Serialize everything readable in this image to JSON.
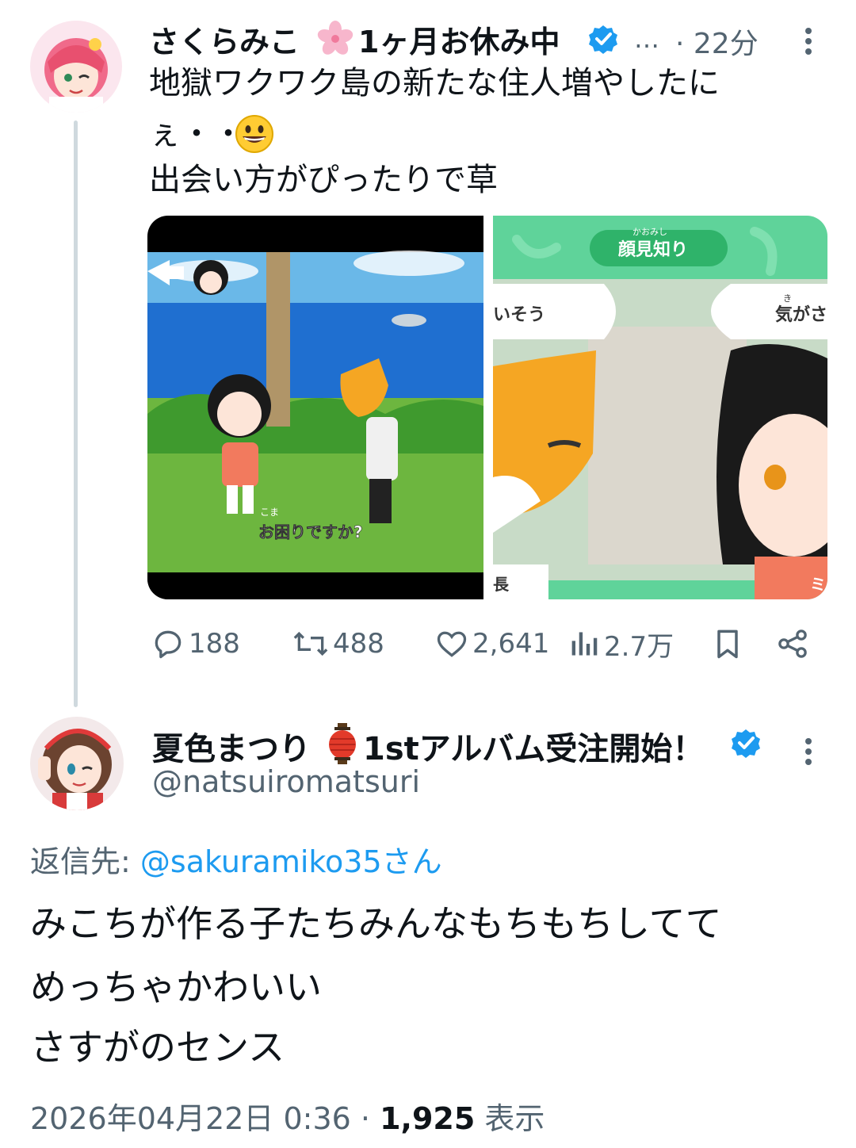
{
  "tweet1": {
    "display_name": "さくらみこ",
    "display_name_suffix": "1ヶ月お休み中",
    "name_emoji": "cherry-blossom",
    "truncation": "…",
    "time": "· 22分",
    "text_lines": [
      "地獄ワクワク島の新たな住人増やしたに",
      "ぇ・・・",
      "出会い方がぴったりで草"
    ],
    "text_emoji": "grinning-face",
    "media": {
      "left_caption_ruby": "こま",
      "left_caption": "お困りですか?",
      "right_sign_ruby": "かおみし",
      "right_sign": "顔見知り",
      "right_bubble_left": "いそう",
      "right_bubble_right_ruby": "き",
      "right_bubble_right": "気がさ",
      "right_bottom_left": "長",
      "right_bottom_right": "ミ"
    },
    "actions": {
      "replies": "188",
      "retweets": "488",
      "likes": "2,641",
      "views": "2.7万"
    }
  },
  "tweet2": {
    "display_name": "夏色まつり",
    "name_emoji": "lantern",
    "display_name_suffix": "1stアルバム受注開始！",
    "handle": "@natsuiromatsuri",
    "reply_label": "返信先:",
    "reply_mention": "@sakuramiko35さん",
    "text_lines": [
      "みこちが作る子たちみんなもちもちしてて",
      "めっちゃかわいい",
      "さすがのセンス"
    ],
    "timestamp": "2026年04月22日 0:36",
    "separator": "·",
    "views_count": "1,925",
    "views_label": "表示"
  },
  "colors": {
    "text": "#0f1419",
    "secondary": "#536471",
    "link": "#1d9bf0",
    "verified": "#1d9bf0",
    "thread_line": "#cfd9de"
  }
}
